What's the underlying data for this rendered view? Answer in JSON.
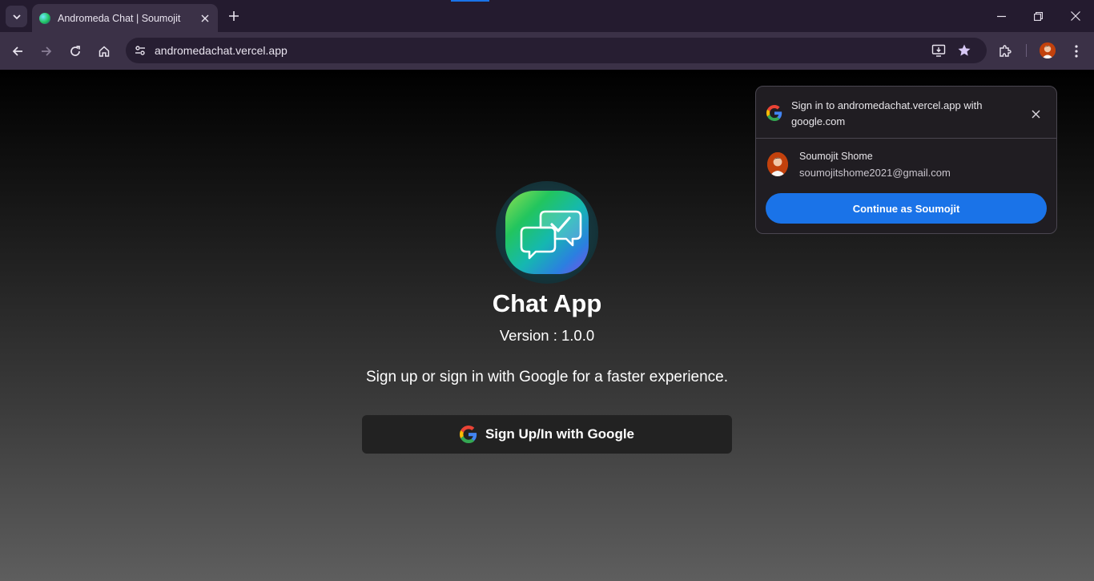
{
  "browser": {
    "tab_title": "Andromeda Chat | Soumojit",
    "url": "andromedachat.vercel.app",
    "icons": {
      "tab_search": "chevron-down-icon",
      "tab_close": "close-icon",
      "new_tab": "plus-icon",
      "minimize": "minimize-icon",
      "restore": "restore-icon",
      "close_window": "close-icon",
      "back": "arrow-left-icon",
      "forward": "arrow-right-icon",
      "reload": "reload-icon",
      "home": "home-icon",
      "site_info": "tune-icon",
      "install_app": "install-icon",
      "bookmark": "star-icon",
      "extensions": "puzzle-icon",
      "menu": "kebab-menu-icon"
    }
  },
  "page": {
    "app_title": "Chat App",
    "version": "Version : 1.0.0",
    "tagline": "Sign up or sign in with Google for a faster experience.",
    "google_button_label": "Sign Up/In with Google"
  },
  "popup": {
    "heading": "Sign in to andromedachat.vercel.app with google.com",
    "account_name": "Soumojit Shome",
    "account_email": "soumojitshome2021@gmail.com",
    "continue_label": "Continue as Soumojit"
  },
  "colors": {
    "chrome_dark": "#241b2f",
    "chrome_toolbar": "#3b3147",
    "accent_blue": "#1a73e8",
    "button_dark": "#222222"
  }
}
